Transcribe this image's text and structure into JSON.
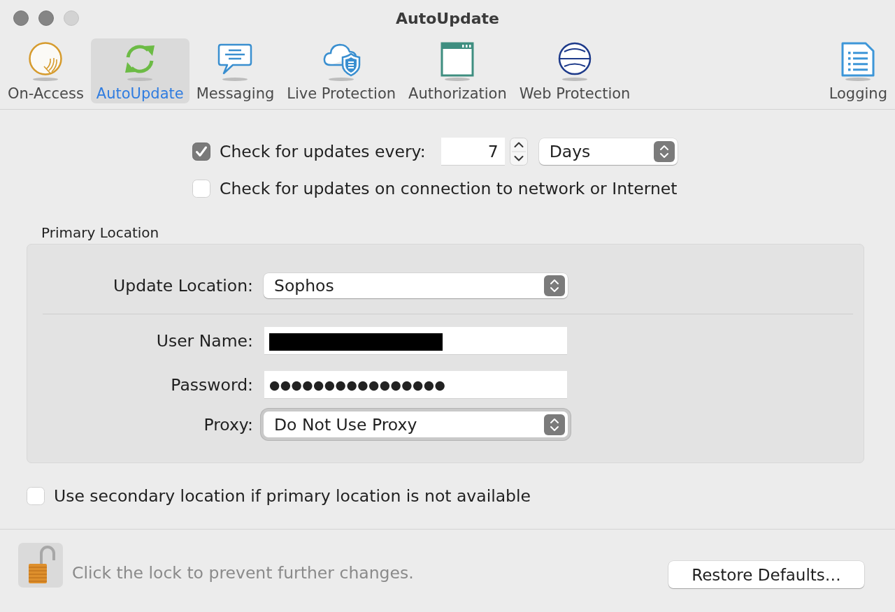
{
  "window": {
    "title": "AutoUpdate",
    "traffic_lights": [
      {
        "disabled": false
      },
      {
        "disabled": false
      },
      {
        "disabled": true
      }
    ]
  },
  "toolbar": {
    "items": [
      {
        "label": "On-Access",
        "kind": "scan",
        "selected": false
      },
      {
        "label": "AutoUpdate",
        "kind": "sync",
        "selected": true
      },
      {
        "label": "Messaging",
        "kind": "chat",
        "selected": false
      },
      {
        "label": "Live Protection",
        "kind": "cloud",
        "selected": false
      },
      {
        "label": "Authorization",
        "kind": "window",
        "selected": false
      },
      {
        "label": "Web Protection",
        "kind": "globe",
        "selected": false
      }
    ],
    "end_items": [
      {
        "label": "Logging",
        "kind": "list",
        "selected": false
      }
    ]
  },
  "schedule": {
    "checked": true,
    "label": "Check for updates every:",
    "interval": "7",
    "unit": "Days"
  },
  "on_connection": {
    "checked": false,
    "label": "Check for updates on connection to network or Internet"
  },
  "primary_location": {
    "title": "Primary Location",
    "update_location": {
      "label": "Update Location:",
      "value": "Sophos"
    },
    "user_name": {
      "label": "User Name:",
      "redacted": true
    },
    "password": {
      "label": "Password:",
      "value": "●●●●●●●●●●●●●●●●"
    },
    "proxy": {
      "label": "Proxy:",
      "value": "Do Not Use Proxy",
      "focused": true
    }
  },
  "secondary_location": {
    "checked": false,
    "label": "Use secondary location if primary location is not available"
  },
  "footer": {
    "locked": false,
    "message": "Click the lock to prevent further changes.",
    "button": "Restore Defaults…"
  }
}
